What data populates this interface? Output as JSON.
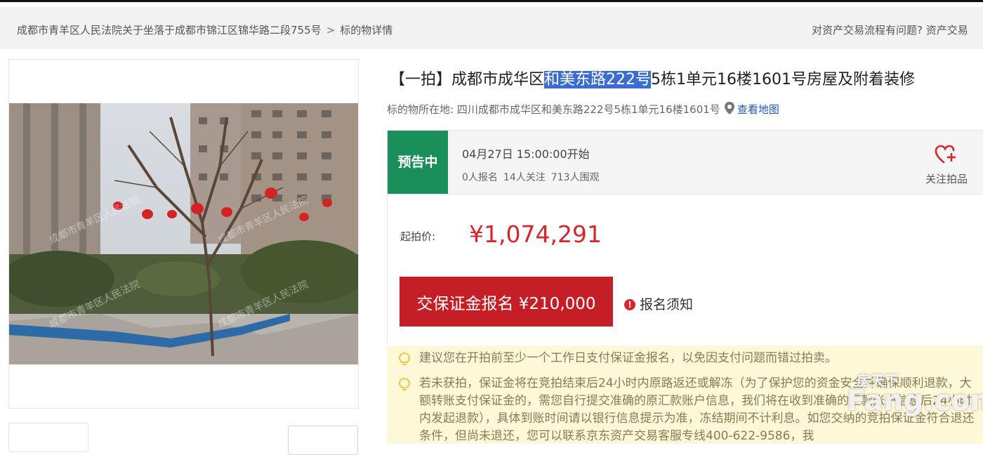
{
  "breadcrumb": {
    "item1": "成都市青羊区人民法院关于坐落于成都市锦江区锦华路二段755号",
    "separator": ">",
    "item2": "标的物详情"
  },
  "help_text": "对资产交易流程有问题? 资产交易",
  "title": {
    "prefix": "【一拍】成都市成华区",
    "highlight": "和美东路222号",
    "suffix": "5栋1单元16楼1601号房屋及附着装修"
  },
  "location": {
    "label": "标的物所在地: ",
    "address": "四川成都市成华区和美东路222号5栋1单元16楼1601号",
    "map_link": "查看地图"
  },
  "status": {
    "badge": "预告中",
    "start_time": "04月27日 15:00:00开始",
    "signups": "0人报名",
    "followers": "14人关注",
    "viewers": "713人围观",
    "follow_label": "关注拍品"
  },
  "price": {
    "label": "起拍价:",
    "value": "¥1,074,291"
  },
  "deposit_button": "交保证金报名 ¥210,000",
  "notice_link": "报名须知",
  "tips": [
    "建议您在开拍前至少一个工作日支付保证金报名，以免因支付问题而错过拍卖。",
    "若未获拍，保证金将在竞拍结束后24小时内原路返还或解冻（为了保护您的资金安全并确保顺利退款，大额转账支付保证金的，需您自行提交准确的原汇款账户信息，我们将在收到准确的汇款账户信息后24小时内发起退款），具体到账时间请以银行信息提示为准，冻结期间不计利息。如您交纳的竞拍保证金符合退还条件，但尚未退还，您可以联系京东资产交易客服专线400-622-9586，我"
  ],
  "watermark": {
    "cn": "房天下",
    "en": "Fang.com"
  },
  "colors": {
    "badge_green": "#1b8f5a",
    "price_red": "#d9242c",
    "button_red": "#c61e27",
    "tip_bg": "#fdf8d8",
    "link_blue": "#1a56c4"
  }
}
